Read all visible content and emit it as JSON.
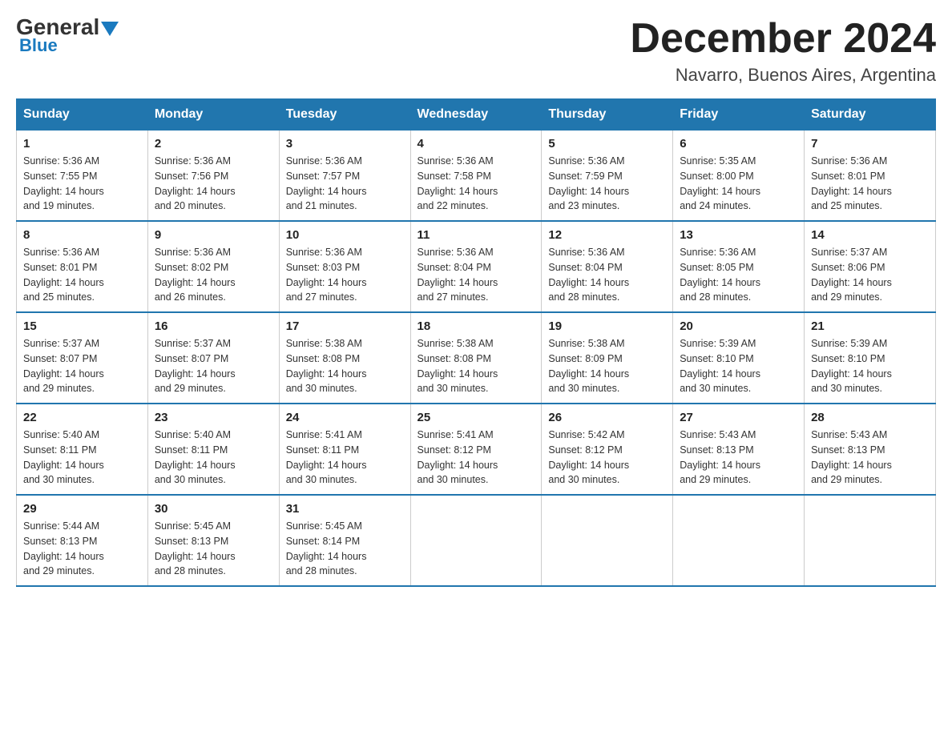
{
  "logo": {
    "general": "General",
    "arrow": "▶",
    "blue": "Blue"
  },
  "title": {
    "month_year": "December 2024",
    "location": "Navarro, Buenos Aires, Argentina"
  },
  "weekdays": [
    "Sunday",
    "Monday",
    "Tuesday",
    "Wednesday",
    "Thursday",
    "Friday",
    "Saturday"
  ],
  "weeks": [
    [
      {
        "day": "1",
        "sunrise": "5:36 AM",
        "sunset": "7:55 PM",
        "daylight": "14 hours and 19 minutes."
      },
      {
        "day": "2",
        "sunrise": "5:36 AM",
        "sunset": "7:56 PM",
        "daylight": "14 hours and 20 minutes."
      },
      {
        "day": "3",
        "sunrise": "5:36 AM",
        "sunset": "7:57 PM",
        "daylight": "14 hours and 21 minutes."
      },
      {
        "day": "4",
        "sunrise": "5:36 AM",
        "sunset": "7:58 PM",
        "daylight": "14 hours and 22 minutes."
      },
      {
        "day": "5",
        "sunrise": "5:36 AM",
        "sunset": "7:59 PM",
        "daylight": "14 hours and 23 minutes."
      },
      {
        "day": "6",
        "sunrise": "5:35 AM",
        "sunset": "8:00 PM",
        "daylight": "14 hours and 24 minutes."
      },
      {
        "day": "7",
        "sunrise": "5:36 AM",
        "sunset": "8:01 PM",
        "daylight": "14 hours and 25 minutes."
      }
    ],
    [
      {
        "day": "8",
        "sunrise": "5:36 AM",
        "sunset": "8:01 PM",
        "daylight": "14 hours and 25 minutes."
      },
      {
        "day": "9",
        "sunrise": "5:36 AM",
        "sunset": "8:02 PM",
        "daylight": "14 hours and 26 minutes."
      },
      {
        "day": "10",
        "sunrise": "5:36 AM",
        "sunset": "8:03 PM",
        "daylight": "14 hours and 27 minutes."
      },
      {
        "day": "11",
        "sunrise": "5:36 AM",
        "sunset": "8:04 PM",
        "daylight": "14 hours and 27 minutes."
      },
      {
        "day": "12",
        "sunrise": "5:36 AM",
        "sunset": "8:04 PM",
        "daylight": "14 hours and 28 minutes."
      },
      {
        "day": "13",
        "sunrise": "5:36 AM",
        "sunset": "8:05 PM",
        "daylight": "14 hours and 28 minutes."
      },
      {
        "day": "14",
        "sunrise": "5:37 AM",
        "sunset": "8:06 PM",
        "daylight": "14 hours and 29 minutes."
      }
    ],
    [
      {
        "day": "15",
        "sunrise": "5:37 AM",
        "sunset": "8:07 PM",
        "daylight": "14 hours and 29 minutes."
      },
      {
        "day": "16",
        "sunrise": "5:37 AM",
        "sunset": "8:07 PM",
        "daylight": "14 hours and 29 minutes."
      },
      {
        "day": "17",
        "sunrise": "5:38 AM",
        "sunset": "8:08 PM",
        "daylight": "14 hours and 30 minutes."
      },
      {
        "day": "18",
        "sunrise": "5:38 AM",
        "sunset": "8:08 PM",
        "daylight": "14 hours and 30 minutes."
      },
      {
        "day": "19",
        "sunrise": "5:38 AM",
        "sunset": "8:09 PM",
        "daylight": "14 hours and 30 minutes."
      },
      {
        "day": "20",
        "sunrise": "5:39 AM",
        "sunset": "8:10 PM",
        "daylight": "14 hours and 30 minutes."
      },
      {
        "day": "21",
        "sunrise": "5:39 AM",
        "sunset": "8:10 PM",
        "daylight": "14 hours and 30 minutes."
      }
    ],
    [
      {
        "day": "22",
        "sunrise": "5:40 AM",
        "sunset": "8:11 PM",
        "daylight": "14 hours and 30 minutes."
      },
      {
        "day": "23",
        "sunrise": "5:40 AM",
        "sunset": "8:11 PM",
        "daylight": "14 hours and 30 minutes."
      },
      {
        "day": "24",
        "sunrise": "5:41 AM",
        "sunset": "8:11 PM",
        "daylight": "14 hours and 30 minutes."
      },
      {
        "day": "25",
        "sunrise": "5:41 AM",
        "sunset": "8:12 PM",
        "daylight": "14 hours and 30 minutes."
      },
      {
        "day": "26",
        "sunrise": "5:42 AM",
        "sunset": "8:12 PM",
        "daylight": "14 hours and 30 minutes."
      },
      {
        "day": "27",
        "sunrise": "5:43 AM",
        "sunset": "8:13 PM",
        "daylight": "14 hours and 29 minutes."
      },
      {
        "day": "28",
        "sunrise": "5:43 AM",
        "sunset": "8:13 PM",
        "daylight": "14 hours and 29 minutes."
      }
    ],
    [
      {
        "day": "29",
        "sunrise": "5:44 AM",
        "sunset": "8:13 PM",
        "daylight": "14 hours and 29 minutes."
      },
      {
        "day": "30",
        "sunrise": "5:45 AM",
        "sunset": "8:13 PM",
        "daylight": "14 hours and 28 minutes."
      },
      {
        "day": "31",
        "sunrise": "5:45 AM",
        "sunset": "8:14 PM",
        "daylight": "14 hours and 28 minutes."
      },
      null,
      null,
      null,
      null
    ]
  ],
  "labels": {
    "sunrise": "Sunrise:",
    "sunset": "Sunset:",
    "daylight": "Daylight:"
  }
}
